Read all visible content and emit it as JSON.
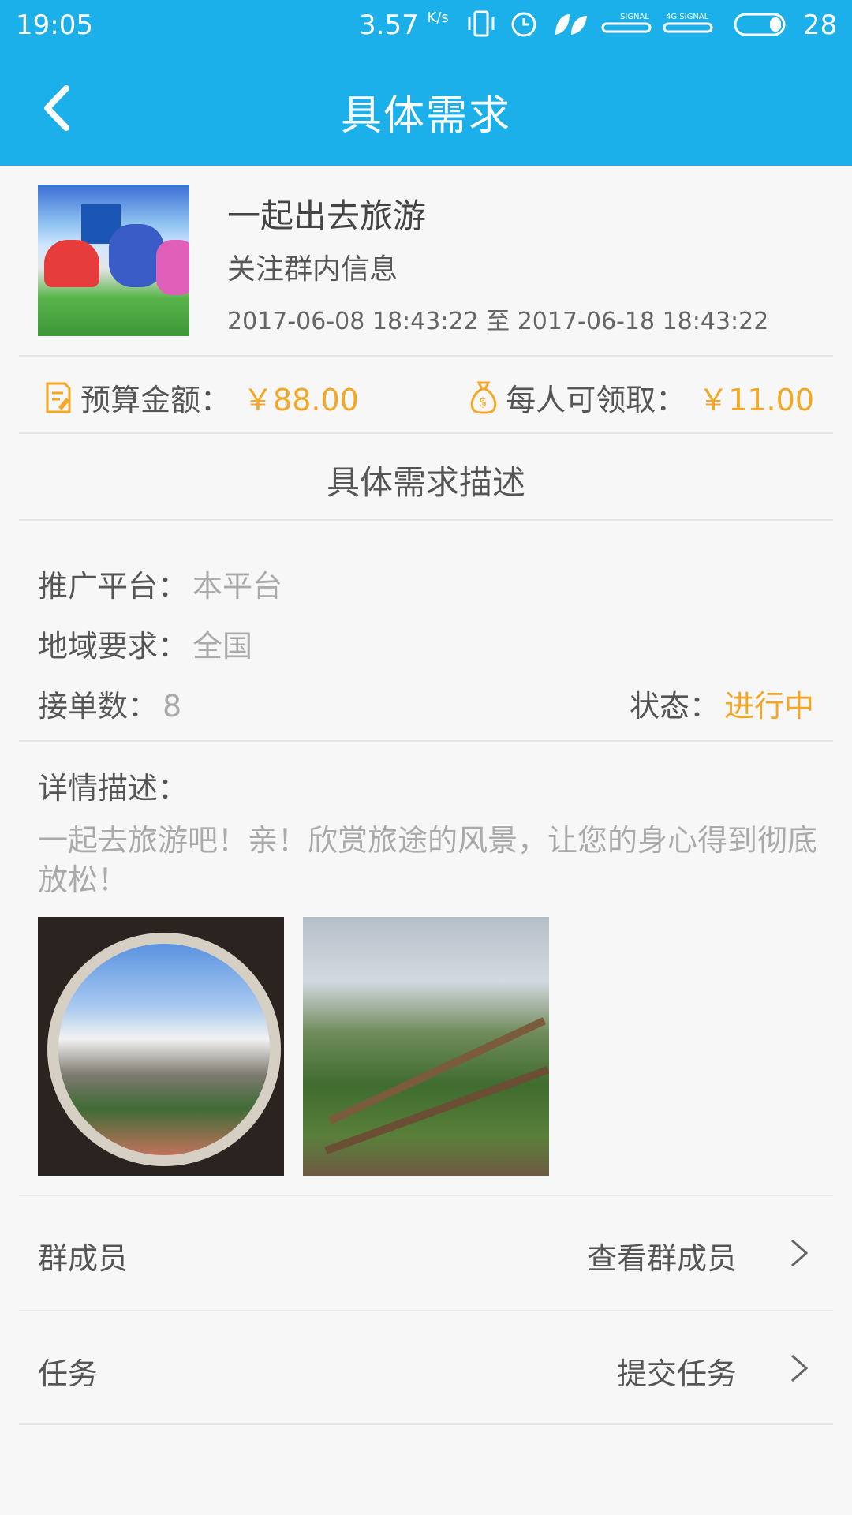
{
  "status_bar": {
    "time": "19:05",
    "speed": "3.57",
    "speed_unit": "K/s",
    "battery": "28",
    "icons": [
      "vibrate-icon",
      "alarm-icon",
      "leaf-icon",
      "signal-icon",
      "signal-4g-icon",
      "battery-icon"
    ],
    "signal_labels": [
      "SIGNAL",
      "4G SIGNAL"
    ]
  },
  "nav": {
    "title": "具体需求"
  },
  "item": {
    "title": "一起出去旅游",
    "subtitle": "关注群内信息",
    "date_range": "2017-06-08 18:43:22 至 2017-06-18 18:43:22"
  },
  "money": {
    "budget_label": "预算金额：",
    "budget_value": "￥88.00",
    "per_person_label": "每人可领取：",
    "per_person_value": "￥11.00"
  },
  "section": {
    "title": "具体需求描述"
  },
  "info": {
    "platform_label": "推广平台：",
    "platform_value": "本平台",
    "region_label": "地域要求：",
    "region_value": "全国",
    "orders_label": "接单数：",
    "orders_value": "8",
    "status_label": "状态：",
    "status_value": "进行中"
  },
  "detail": {
    "label": "详情描述：",
    "text": "一起去旅游吧！亲！欣赏旅途的风景，让您的身心得到彻底放松！"
  },
  "rows": {
    "members_label": "群成员",
    "members_action": "查看群成员",
    "task_label": "任务",
    "task_action": "提交任务"
  },
  "colors": {
    "primary": "#1bb0ea",
    "accent": "#f5a623"
  }
}
